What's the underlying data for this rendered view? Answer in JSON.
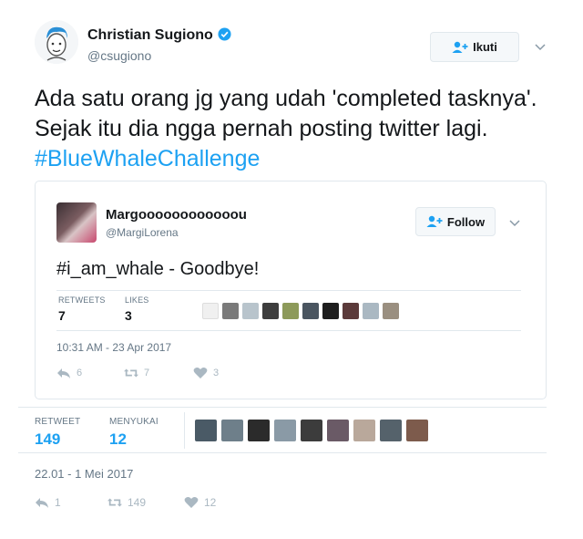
{
  "tweet": {
    "author_name": "Christian Sugiono",
    "author_handle": "@csugiono",
    "follow_label": "Ikuti",
    "text": "Ada satu orang jg yang udah 'completed tasknya'. Sejak itu dia ngga pernah posting twitter lagi. ",
    "hashtag": "#BlueWhaleChallenge",
    "retweet_label": "RETWEET",
    "retweet_count": "149",
    "likes_label": "MENYUKAI",
    "likes_count": "12",
    "timestamp": "22.01 - 1 Mei 2017",
    "actions": {
      "reply_count": "1",
      "retweet_count": "149",
      "like_count": "12"
    },
    "liker_avatars": [
      "avatar-1",
      "avatar-2",
      "avatar-3",
      "avatar-4",
      "avatar-5",
      "avatar-6",
      "avatar-7",
      "avatar-8",
      "avatar-9"
    ]
  },
  "quoted": {
    "author_name": "Margoooooooooooou",
    "author_handle": "@MargiLorena",
    "follow_label": "Follow",
    "text": "#i_am_whale - Goodbye!",
    "retweets_label": "RETWEETS",
    "retweets_count": "7",
    "likes_label": "LIKES",
    "likes_count": "3",
    "timestamp": "10:31 AM - 23 Apr 2017",
    "actions": {
      "reply_count": "6",
      "retweet_count": "7",
      "like_count": "3"
    },
    "liker_avatars": [
      "avatar-1",
      "avatar-2",
      "avatar-3",
      "avatar-4",
      "avatar-5",
      "avatar-6",
      "avatar-7",
      "avatar-8",
      "avatar-9",
      "avatar-10"
    ]
  },
  "colors": {
    "accent": "#1da1f2",
    "verified": "#1da1f2",
    "muted": "#657786",
    "icon": "#aab8c2"
  },
  "icons": [
    "verified-badge-icon",
    "follow-person-icon",
    "chevron-down-icon",
    "reply-icon",
    "retweet-icon",
    "heart-icon"
  ]
}
